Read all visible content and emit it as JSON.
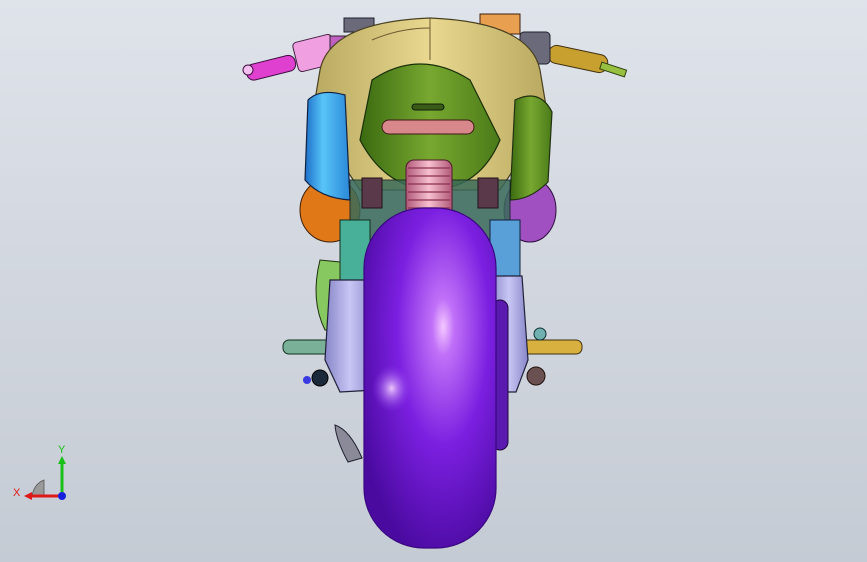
{
  "viewport": {
    "background_top": "#dfe3ea",
    "background_bottom": "#c5cbd4"
  },
  "model": {
    "tire_color": "#7b1fe0",
    "fairing_color": "#d8c678",
    "tank_left_color": "#3aa6e8",
    "tank_right_color": "#5f8a1e",
    "seat_color": "#4e8a2a",
    "spring_color": "#e8a0b8",
    "swingarm_color": "#a9a8e6",
    "left_grip_color": "#e040d0",
    "right_grip_color": "#c8a030",
    "left_pod_color": "#e07818",
    "right_pod_color": "#a050c0"
  },
  "triad": {
    "x_label": "X",
    "y_label": "Y",
    "x_color": "#e01818",
    "y_color": "#18c018",
    "z_color": "#1820e0"
  }
}
